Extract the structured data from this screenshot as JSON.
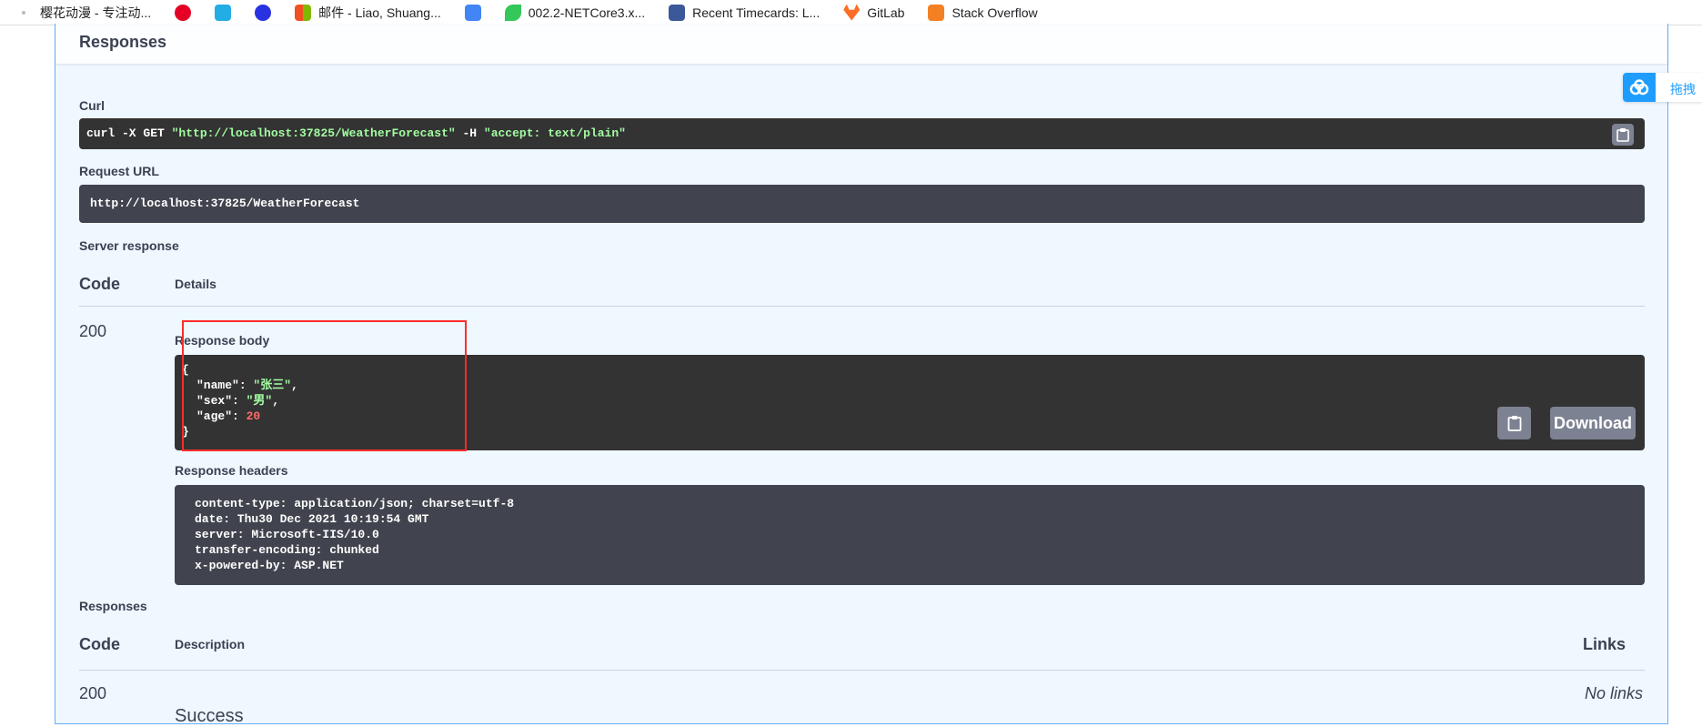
{
  "bookmarks": [
    {
      "label": "樱花动漫 - 专注动...",
      "icon": "sakura-icon",
      "color": "#ffffff"
    },
    {
      "label": "",
      "icon": "netease-music-icon",
      "color": "#e60026"
    },
    {
      "label": "",
      "icon": "bilibili-icon",
      "color": "#23ade5"
    },
    {
      "label": "",
      "icon": "baidu-paw-icon",
      "color": "#2932e1"
    },
    {
      "label": "邮件 - Liao, Shuang...",
      "icon": "microsoft-icon",
      "color": "#f25022"
    },
    {
      "label": "",
      "icon": "translate-icon",
      "color": "#4285f4"
    },
    {
      "label": "002.2-NETCore3.x...",
      "icon": "leaf-icon",
      "color": "#34c759"
    },
    {
      "label": "Recent Timecards: L...",
      "icon": "timecard-icon",
      "color": "#3b5998"
    },
    {
      "label": "GitLab",
      "icon": "gitlab-icon",
      "color": "#fc6d26"
    },
    {
      "label": "Stack Overflow",
      "icon": "stackoverflow-icon",
      "color": "#f48024"
    }
  ],
  "responses_title": "Responses",
  "curl": {
    "label": "Curl",
    "cmd": "curl -X GET ",
    "url": "\"http://localhost:37825/WeatherForecast\"",
    "flag": " -H  ",
    "header": "\"accept: text/plain\""
  },
  "request_url": {
    "label": "Request URL",
    "value": "http://localhost:37825/WeatherForecast"
  },
  "server_response": {
    "label": "Server response",
    "col_code": "Code",
    "col_details": "Details",
    "code": "200",
    "body_label": "Response body",
    "body": {
      "open": "{",
      "name_key": "\"name\"",
      "name_val": "\"张三\"",
      "sex_key": "\"sex\"",
      "sex_val": "\"男\"",
      "age_key": "\"age\"",
      "age_val": "20",
      "close": "}"
    },
    "download_label": "Download",
    "headers_label": "Response headers",
    "headers": [
      "content-type: application/json; charset=utf-8",
      "date: Thu30 Dec 2021 10:19:54 GMT",
      "server: Microsoft-IIS/10.0",
      "transfer-encoding: chunked",
      "x-powered-by: ASP.NET"
    ]
  },
  "responses": {
    "label": "Responses",
    "col_code": "Code",
    "col_description": "Description",
    "col_links": "Links",
    "code": "200",
    "description": "Success",
    "links": "No links"
  },
  "baidu_widget": {
    "label": "拖拽"
  }
}
